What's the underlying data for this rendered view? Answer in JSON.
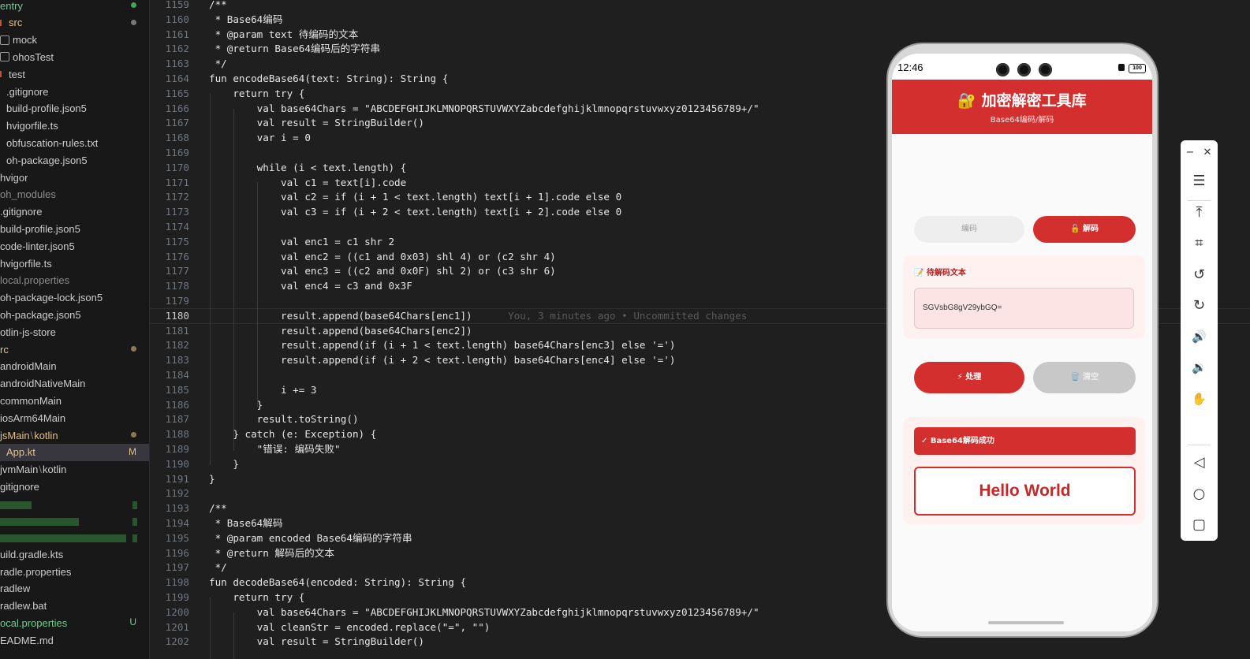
{
  "explorer": {
    "items": [
      {
        "label": "entry",
        "style": "git",
        "dot": "#3fa65a"
      },
      {
        "label": "src",
        "style": "mod",
        "dot": "#777777",
        "prefix": "red"
      },
      {
        "label": "mock",
        "style": "normal",
        "folder": true
      },
      {
        "label": "ohosTest",
        "style": "normal",
        "folder": true
      },
      {
        "label": "test",
        "style": "normal",
        "prefix": "red"
      },
      {
        "label": ".gitignore",
        "style": "normal"
      },
      {
        "label": "build-profile.json5",
        "style": "normal"
      },
      {
        "label": "hvigorfile.ts",
        "style": "normal"
      },
      {
        "label": "obfuscation-rules.txt",
        "style": "normal"
      },
      {
        "label": "oh-package.json5",
        "style": "normal"
      },
      {
        "label": "hvigor",
        "style": "normal"
      },
      {
        "label": "oh_modules",
        "style": "dim"
      },
      {
        "label": ".gitignore",
        "style": "normal"
      },
      {
        "label": "build-profile.json5",
        "style": "normal"
      },
      {
        "label": "code-linter.json5",
        "style": "normal"
      },
      {
        "label": "hvigorfile.ts",
        "style": "normal"
      },
      {
        "label": "local.properties",
        "style": "dim"
      },
      {
        "label": "oh-package-lock.json5",
        "style": "normal"
      },
      {
        "label": "oh-package.json5",
        "style": "normal"
      },
      {
        "label": "otlin-js-store",
        "style": "normal"
      },
      {
        "label": "rc",
        "style": "mod",
        "dot": "#8a7a55"
      },
      {
        "label": "androidMain",
        "style": "normal"
      },
      {
        "label": "androidNativeMain",
        "style": "normal"
      },
      {
        "label": "commonMain",
        "style": "normal"
      },
      {
        "label": "iosArm64Main",
        "style": "normal"
      },
      {
        "label": "jsMain",
        "label2": "kotlin",
        "style": "mod",
        "dot": "#8a7a55"
      },
      {
        "label": "App.kt",
        "style": "mod",
        "badge": "M",
        "selected": true
      },
      {
        "label": "jvmMain",
        "label2": "kotlin",
        "style": "normal"
      },
      {
        "label": "gitignore",
        "style": "normal"
      },
      {
        "label": "uild.gradle.kts",
        "style": "normal",
        "after_blur": true
      },
      {
        "label": "radle.properties",
        "style": "normal"
      },
      {
        "label": "radlew",
        "style": "normal"
      },
      {
        "label": "radlew.bat",
        "style": "normal"
      },
      {
        "label": "ocal.properties",
        "style": "git",
        "badge": "U"
      },
      {
        "label": "EADME.md",
        "style": "normal"
      }
    ]
  },
  "editor": {
    "lines": [
      {
        "n": "1159",
        "t": "/**"
      },
      {
        "n": "1160",
        "t": " * Base64编码"
      },
      {
        "n": "1161",
        "t": " * @param text 待编码的文本"
      },
      {
        "n": "1162",
        "t": " * @return Base64编码后的字符串"
      },
      {
        "n": "1163",
        "t": " */"
      },
      {
        "n": "1164",
        "t": "fun encodeBase64(text: String): String {"
      },
      {
        "n": "1165",
        "t": "    return try {"
      },
      {
        "n": "1166",
        "t": "        val base64Chars = \"ABCDEFGHIJKLMNOPQRSTUVWXYZabcdefghijklmnopqrstuvwxyz0123456789+/\""
      },
      {
        "n": "1167",
        "t": "        val result = StringBuilder()"
      },
      {
        "n": "1168",
        "t": "        var i = 0"
      },
      {
        "n": "1169",
        "t": ""
      },
      {
        "n": "1170",
        "t": "        while (i < text.length) {"
      },
      {
        "n": "1171",
        "t": "            val c1 = text[i].code"
      },
      {
        "n": "1172",
        "t": "            val c2 = if (i + 1 < text.length) text[i + 1].code else 0"
      },
      {
        "n": "1173",
        "t": "            val c3 = if (i + 2 < text.length) text[i + 2].code else 0"
      },
      {
        "n": "1174",
        "t": ""
      },
      {
        "n": "1175",
        "t": "            val enc1 = c1 shr 2"
      },
      {
        "n": "1176",
        "t": "            val enc2 = ((c1 and 0x03) shl 4) or (c2 shr 4)"
      },
      {
        "n": "1177",
        "t": "            val enc3 = ((c2 and 0x0F) shl 2) or (c3 shr 6)"
      },
      {
        "n": "1178",
        "t": "            val enc4 = c3 and 0x3F"
      },
      {
        "n": "1179",
        "t": ""
      },
      {
        "n": "1180",
        "t": "            result.append(base64Chars[enc1])",
        "blame": "      You, 3 minutes ago • Uncommitted changes",
        "active": true
      },
      {
        "n": "1181",
        "t": "            result.append(base64Chars[enc2])"
      },
      {
        "n": "1182",
        "t": "            result.append(if (i + 1 < text.length) base64Chars[enc3] else '=')"
      },
      {
        "n": "1183",
        "t": "            result.append(if (i + 2 < text.length) base64Chars[enc4] else '=')"
      },
      {
        "n": "1184",
        "t": ""
      },
      {
        "n": "1185",
        "t": "            i += 3"
      },
      {
        "n": "1186",
        "t": "        }"
      },
      {
        "n": "1187",
        "t": "        result.toString()"
      },
      {
        "n": "1188",
        "t": "    } catch (e: Exception) {"
      },
      {
        "n": "1189",
        "t": "        \"错误: 编码失败\""
      },
      {
        "n": "1190",
        "t": "    }"
      },
      {
        "n": "1191",
        "t": "}"
      },
      {
        "n": "1192",
        "t": ""
      },
      {
        "n": "1193",
        "t": "/**"
      },
      {
        "n": "1194",
        "t": " * Base64解码"
      },
      {
        "n": "1195",
        "t": " * @param encoded Base64编码的字符串"
      },
      {
        "n": "1196",
        "t": " * @return 解码后的文本"
      },
      {
        "n": "1197",
        "t": " */"
      },
      {
        "n": "1198",
        "t": "fun decodeBase64(encoded: String): String {"
      },
      {
        "n": "1199",
        "t": "    return try {"
      },
      {
        "n": "1200",
        "t": "        val base64Chars = \"ABCDEFGHIJKLMNOPQRSTUVWXYZabcdefghijklmnopqrstuvwxyz0123456789+/\""
      },
      {
        "n": "1201",
        "t": "        val cleanStr = encoded.replace(\"=\", \"\")"
      },
      {
        "n": "1202",
        "t": "        val result = StringBuilder()"
      }
    ]
  },
  "phone": {
    "status": {
      "time": "12:46",
      "battery": "100"
    },
    "header": {
      "title": "🔐 加密解密工具库",
      "subtitle": "Base64编码/解码"
    },
    "tabs": {
      "encode": "编码",
      "decode": "🔓 解码"
    },
    "input_card": {
      "label": "📝 待解码文本",
      "value": "SGVsbG8gV29ybGQ="
    },
    "buttons": {
      "process": "⚡ 处理",
      "clear": "🗑️ 清空"
    },
    "result": {
      "status": "✓ Base64解码成功",
      "value": "Hello World"
    }
  },
  "toolbar": {
    "minimize": "−",
    "close": "✕",
    "menu": "☰",
    "top": "⤒",
    "crop": "⌗",
    "rotate_left": "↺",
    "rotate_right": "↻",
    "vol_up": "🔊",
    "vol_down": "🔉",
    "shake": "✋",
    "back": "◁",
    "home": "○",
    "recent": "▢"
  },
  "colors": {
    "accent": "#d32f2f",
    "editor_bg": "#1f1f1f",
    "sidebar_bg": "#181818"
  }
}
